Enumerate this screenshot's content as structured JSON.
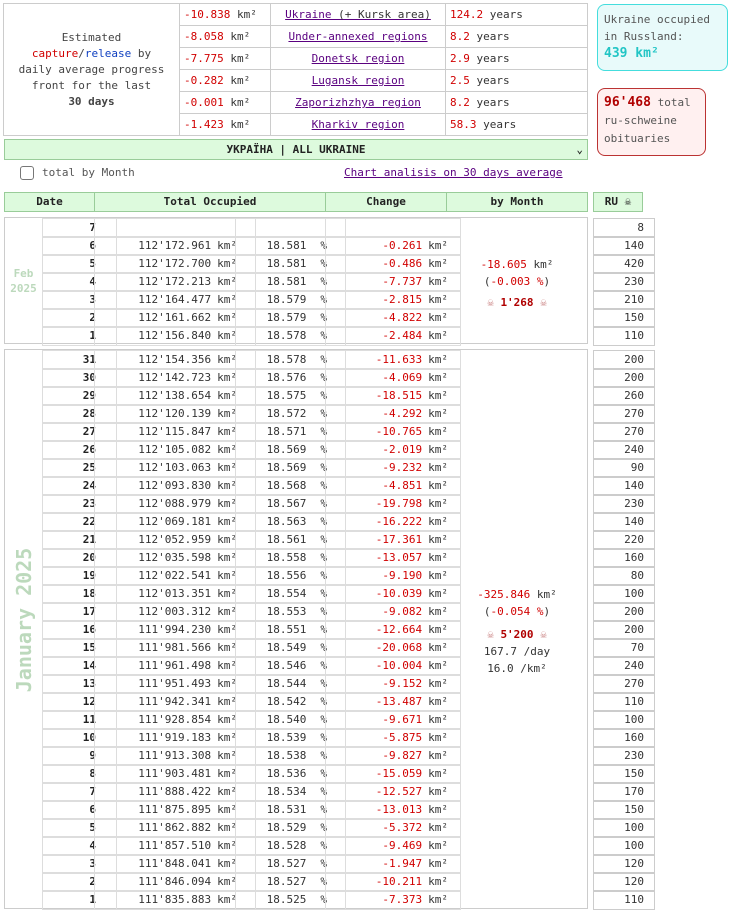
{
  "summary": {
    "intro_estimated": "Estimated",
    "intro_capture": "capture",
    "intro_slash": "/",
    "intro_release": "release",
    "intro_by": " by",
    "intro_line2": "daily average progress",
    "intro_line3": "front for the last",
    "intro_days": "30 days",
    "unit": "km²",
    "years_unit": "years",
    "rows": [
      {
        "delta": "-10.838",
        "region": "Ukraine",
        "extra": " (+ Kursk area)",
        "years": "124.2"
      },
      {
        "delta": "-8.058",
        "region": "Under-annexed regions",
        "extra": "",
        "years": "8.2"
      },
      {
        "delta": "-7.775",
        "region": "Donetsk region",
        "extra": "",
        "years": "2.9"
      },
      {
        "delta": "-0.282",
        "region": "Lugansk region",
        "extra": "",
        "years": "2.5"
      },
      {
        "delta": "-0.001",
        "region": "Zaporizhzhya region",
        "extra": "",
        "years": "8.2"
      },
      {
        "delta": "-1.423",
        "region": "Kharkiv region",
        "extra": "",
        "years": "58.3"
      }
    ]
  },
  "occupied_russland": {
    "line1": "Ukraine occupied",
    "line2": "in Russland:",
    "value": "439 km²"
  },
  "obituaries": {
    "value": "96'468",
    "w1": " total",
    "line2": "ru-schweine",
    "line3": "obituaries"
  },
  "region_select": {
    "value": "УКРАЇНА | ALL UKRAINE"
  },
  "controls": {
    "month_label": "total by Month",
    "chart_link": "Chart analisis on 30 days average"
  },
  "headers": {
    "date": "Date",
    "total": "Total Occupied",
    "change": "Change",
    "by_month": "by Month",
    "ru": "RU ☠"
  },
  "feb": {
    "month": "Feb",
    "year": "2025",
    "rows": [
      {
        "day": "7",
        "total": "",
        "pct": "",
        "chg": "",
        "ru": "8"
      },
      {
        "day": "6",
        "total": "112'172.961",
        "pct": "18.581",
        "chg": "-0.261",
        "ru": "140"
      },
      {
        "day": "5",
        "total": "112'172.700",
        "pct": "18.581",
        "chg": "-0.486",
        "ru": "420"
      },
      {
        "day": "4",
        "total": "112'172.213",
        "pct": "18.581",
        "chg": "-7.737",
        "ru": "230"
      },
      {
        "day": "3",
        "total": "112'164.477",
        "pct": "18.579",
        "chg": "-2.815",
        "ru": "210"
      },
      {
        "day": "2",
        "total": "112'161.662",
        "pct": "18.579",
        "chg": "-4.822",
        "ru": "150"
      },
      {
        "day": "1",
        "total": "112'156.840",
        "pct": "18.578",
        "chg": "-2.484",
        "ru": "110"
      }
    ],
    "summary": {
      "change": "-18.605",
      "pct": "-0.003",
      "dead": "1'268"
    }
  },
  "jan": {
    "month": "January 2025",
    "rows": [
      {
        "day": "31",
        "total": "112'154.356",
        "pct": "18.578",
        "chg": "-11.633",
        "ru": "200"
      },
      {
        "day": "30",
        "total": "112'142.723",
        "pct": "18.576",
        "chg": "-4.069",
        "ru": "200"
      },
      {
        "day": "29",
        "total": "112'138.654",
        "pct": "18.575",
        "chg": "-18.515",
        "ru": "260"
      },
      {
        "day": "28",
        "total": "112'120.139",
        "pct": "18.572",
        "chg": "-4.292",
        "ru": "270"
      },
      {
        "day": "27",
        "total": "112'115.847",
        "pct": "18.571",
        "chg": "-10.765",
        "ru": "270"
      },
      {
        "day": "26",
        "total": "112'105.082",
        "pct": "18.569",
        "chg": "-2.019",
        "ru": "240"
      },
      {
        "day": "25",
        "total": "112'103.063",
        "pct": "18.569",
        "chg": "-9.232",
        "ru": "90"
      },
      {
        "day": "24",
        "total": "112'093.830",
        "pct": "18.568",
        "chg": "-4.851",
        "ru": "140"
      },
      {
        "day": "23",
        "total": "112'088.979",
        "pct": "18.567",
        "chg": "-19.798",
        "ru": "230"
      },
      {
        "day": "22",
        "total": "112'069.181",
        "pct": "18.563",
        "chg": "-16.222",
        "ru": "140"
      },
      {
        "day": "21",
        "total": "112'052.959",
        "pct": "18.561",
        "chg": "-17.361",
        "ru": "220"
      },
      {
        "day": "20",
        "total": "112'035.598",
        "pct": "18.558",
        "chg": "-13.057",
        "ru": "160"
      },
      {
        "day": "19",
        "total": "112'022.541",
        "pct": "18.556",
        "chg": "-9.190",
        "ru": "80"
      },
      {
        "day": "18",
        "total": "112'013.351",
        "pct": "18.554",
        "chg": "-10.039",
        "ru": "100"
      },
      {
        "day": "17",
        "total": "112'003.312",
        "pct": "18.553",
        "chg": "-9.082",
        "ru": "200"
      },
      {
        "day": "16",
        "total": "111'994.230",
        "pct": "18.551",
        "chg": "-12.664",
        "ru": "200"
      },
      {
        "day": "15",
        "total": "111'981.566",
        "pct": "18.549",
        "chg": "-20.068",
        "ru": "70"
      },
      {
        "day": "14",
        "total": "111'961.498",
        "pct": "18.546",
        "chg": "-10.004",
        "ru": "240"
      },
      {
        "day": "13",
        "total": "111'951.493",
        "pct": "18.544",
        "chg": "-9.152",
        "ru": "270"
      },
      {
        "day": "12",
        "total": "111'942.341",
        "pct": "18.542",
        "chg": "-13.487",
        "ru": "110"
      },
      {
        "day": "11",
        "total": "111'928.854",
        "pct": "18.540",
        "chg": "-9.671",
        "ru": "100"
      },
      {
        "day": "10",
        "total": "111'919.183",
        "pct": "18.539",
        "chg": "-5.875",
        "ru": "160"
      },
      {
        "day": "9",
        "total": "111'913.308",
        "pct": "18.538",
        "chg": "-9.827",
        "ru": "230"
      },
      {
        "day": "8",
        "total": "111'903.481",
        "pct": "18.536",
        "chg": "-15.059",
        "ru": "150"
      },
      {
        "day": "7",
        "total": "111'888.422",
        "pct": "18.534",
        "chg": "-12.527",
        "ru": "170"
      },
      {
        "day": "6",
        "total": "111'875.895",
        "pct": "18.531",
        "chg": "-13.013",
        "ru": "150"
      },
      {
        "day": "5",
        "total": "111'862.882",
        "pct": "18.529",
        "chg": "-5.372",
        "ru": "100"
      },
      {
        "day": "4",
        "total": "111'857.510",
        "pct": "18.528",
        "chg": "-9.469",
        "ru": "100"
      },
      {
        "day": "3",
        "total": "111'848.041",
        "pct": "18.527",
        "chg": "-1.947",
        "ru": "120"
      },
      {
        "day": "2",
        "total": "111'846.094",
        "pct": "18.527",
        "chg": "-10.211",
        "ru": "120"
      },
      {
        "day": "1",
        "total": "111'835.883",
        "pct": "18.525",
        "chg": "-7.373",
        "ru": "110"
      }
    ],
    "summary": {
      "change": "-325.846",
      "pct": "-0.054",
      "dead": "5'200",
      "per_day": "167.7 /day",
      "per_km": "16.0 /km²"
    }
  },
  "units": {
    "km": "km²",
    "pct": "%",
    "skull": "☠"
  },
  "colors": {
    "accent_green": "#ddfadd",
    "negative_red": "#d10000",
    "link_purple": "#5a0080",
    "teal": "#22c5c5"
  }
}
